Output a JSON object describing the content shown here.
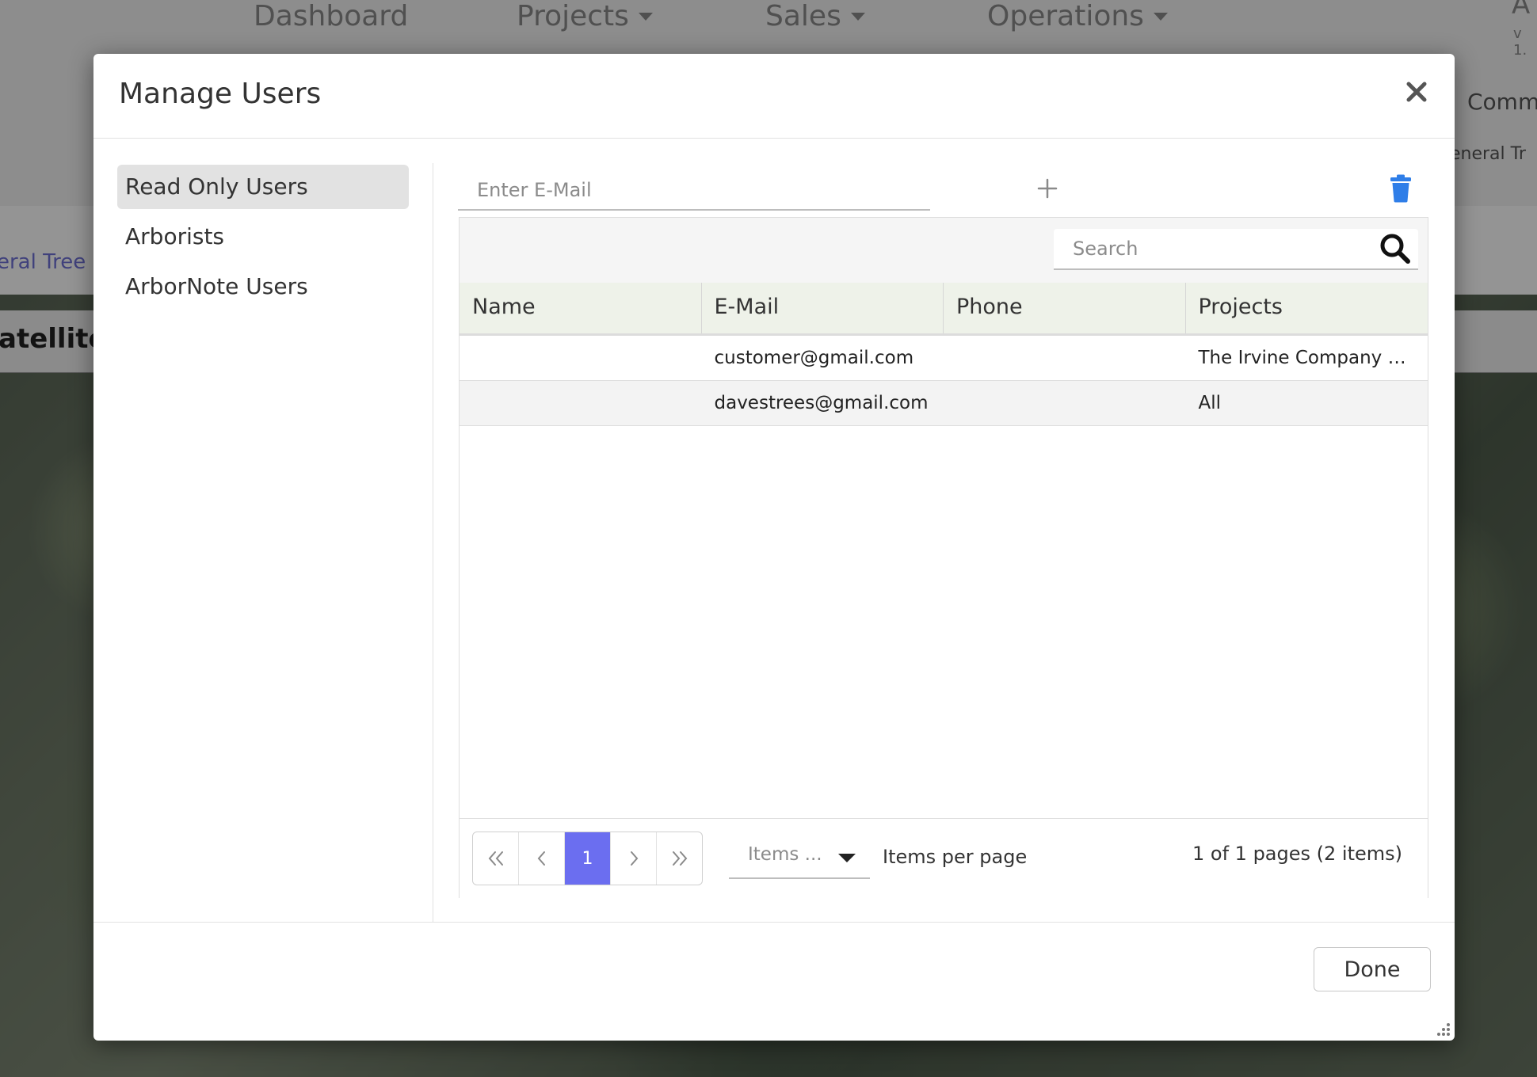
{
  "background": {
    "nav": [
      {
        "label": "Dashboard",
        "caret": false
      },
      {
        "label": "Projects",
        "caret": true
      },
      {
        "label": "Sales",
        "caret": true
      },
      {
        "label": "Operations",
        "caret": true
      }
    ],
    "right_top": "A",
    "version": "v 1.",
    "right_header": "Comm",
    "right_subheader": "eneral Tr",
    "left_link": "eral Tree (",
    "map_mode": "atellite"
  },
  "modal": {
    "title": "Manage Users",
    "sidebar": [
      {
        "label": "Read Only Users",
        "active": true
      },
      {
        "label": "Arborists",
        "active": false
      },
      {
        "label": "ArborNote Users",
        "active": false
      }
    ],
    "email_placeholder": "Enter E-Mail",
    "search_placeholder": "Search",
    "columns": [
      "Name",
      "E-Mail",
      "Phone",
      "Projects"
    ],
    "rows": [
      {
        "name": "",
        "email": "customer@gmail.com",
        "phone": "",
        "projects": "The Irvine Company Ba..."
      },
      {
        "name": "",
        "email": "davestrees@gmail.com",
        "phone": "",
        "projects": "All"
      }
    ],
    "pager": {
      "current_page": "1",
      "items_select": "Items ...",
      "items_per_page_label": "Items per page",
      "page_info": "1 of 1 pages (2 items)"
    },
    "done_label": "Done"
  },
  "colors": {
    "accent": "#6b6ef0",
    "trash": "#2f7ee8",
    "header_bg": "#eef2e9",
    "link": "#6f71d6"
  },
  "icons": {
    "close": "close-icon",
    "add": "plus-icon",
    "delete": "trash-icon",
    "search": "search-icon"
  }
}
